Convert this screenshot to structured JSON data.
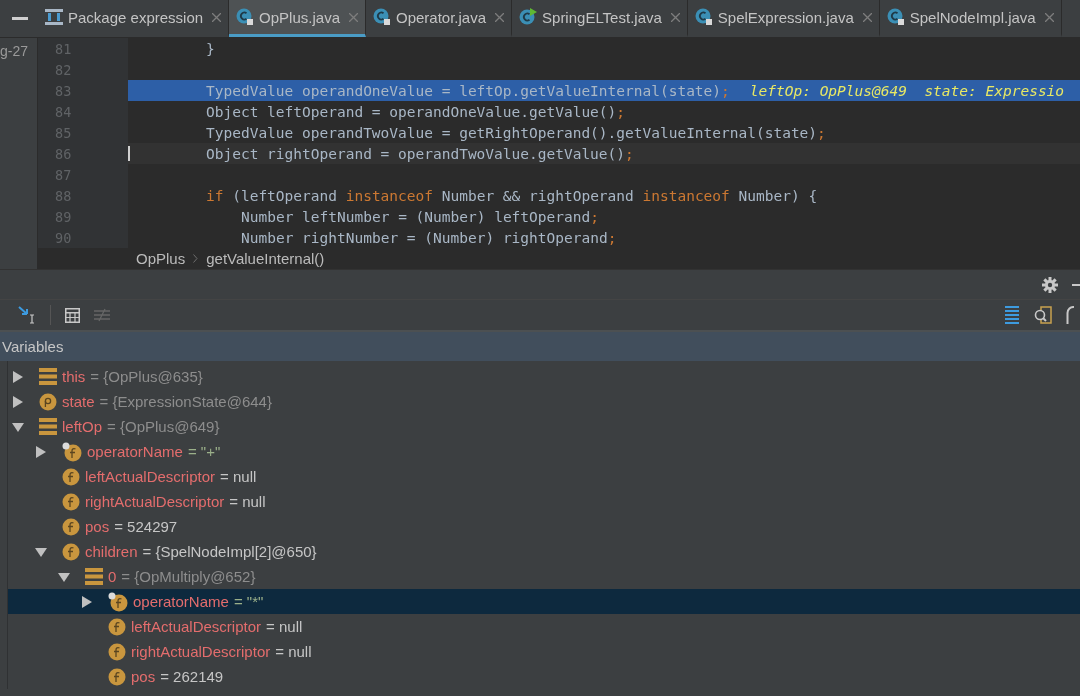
{
  "tabs": [
    {
      "label": "Package expression",
      "kind": "structure",
      "selected": false
    },
    {
      "label": "OpPlus.java",
      "kind": "class",
      "selected": true
    },
    {
      "label": "Operator.java",
      "kind": "class",
      "selected": false
    },
    {
      "label": "SpringELTest.java",
      "kind": "test",
      "selected": false
    },
    {
      "label": "SpelExpression.java",
      "kind": "class",
      "selected": false
    },
    {
      "label": "SpelNodeImpl.java",
      "kind": "class",
      "selected": false
    }
  ],
  "side_label": "g-27",
  "code": {
    "lines": [
      {
        "number": "81",
        "kind": "normal",
        "nested": false,
        "tokens": [
          {
            "kind": "plain",
            "text": "}"
          }
        ]
      },
      {
        "number": "82",
        "kind": "normal"
      },
      {
        "number": "83",
        "kind": "execution",
        "nested": false,
        "tokens": [
          {
            "kind": "plain",
            "text": "TypedValue operandOneValue = leftOp.getValueInternal(state)"
          },
          {
            "kind": "punct",
            "text": ";"
          },
          {
            "kind": "hint",
            "text": "leftOp: OpPlus@649  state: Expressio"
          }
        ]
      },
      {
        "number": "84",
        "kind": "normal",
        "nested": false,
        "tokens": [
          {
            "kind": "plain",
            "text": "Object leftOperand = operandOneValue.getValue()"
          },
          {
            "kind": "punct",
            "text": ";"
          }
        ]
      },
      {
        "number": "85",
        "kind": "normal",
        "nested": false,
        "tokens": [
          {
            "kind": "plain",
            "text": "TypedValue operandTwoValue = getRightOperand().getValueInternal(state)"
          },
          {
            "kind": "punct",
            "text": ";"
          }
        ]
      },
      {
        "number": "86",
        "kind": "caret",
        "nested": false,
        "tokens": [
          {
            "kind": "plain",
            "text": "Object rightOperand = operandTwoValue.getValue()"
          },
          {
            "kind": "punct",
            "text": ";"
          }
        ]
      },
      {
        "number": "87",
        "kind": "normal"
      },
      {
        "number": "88",
        "kind": "normal",
        "nested": false,
        "tokens": [
          {
            "kind": "keyword",
            "text": "if"
          },
          {
            "kind": "plain",
            "text": " (leftOperand "
          },
          {
            "kind": "keyword",
            "text": "instanceof"
          },
          {
            "kind": "plain",
            "text": " Number && rightOperand "
          },
          {
            "kind": "keyword",
            "text": "instanceof"
          },
          {
            "kind": "plain",
            "text": " Number) {"
          }
        ]
      },
      {
        "number": "89",
        "kind": "normal",
        "nested": true,
        "tokens": [
          {
            "kind": "plain",
            "text": "Number leftNumber = (Number) leftOperand"
          },
          {
            "kind": "punct",
            "text": ";"
          }
        ]
      },
      {
        "number": "90",
        "kind": "normal",
        "nested": true,
        "tokens": [
          {
            "kind": "plain",
            "text": "Number rightNumber = (Number) rightOperand"
          },
          {
            "kind": "punct",
            "text": ";"
          }
        ]
      }
    ]
  },
  "breadcrumb": [
    "OpPlus",
    "getValueInternal()"
  ],
  "variables": {
    "title": "Variables",
    "items": [
      {
        "name": "this",
        "value": "= {OpPlus@635}",
        "kind": "object",
        "has_children": true,
        "expanded": false,
        "selected": false
      },
      {
        "name": "state",
        "value": "= {ExpressionState@644}",
        "kind": "param",
        "has_children": true,
        "expanded": false,
        "selected": false
      },
      {
        "name": "leftOp",
        "value": "= {OpPlus@649}",
        "kind": "object",
        "has_children": true,
        "expanded": true,
        "selected": false,
        "children": [
          {
            "name": "operatorName",
            "value": "= \"+\"",
            "kind": "field_marked",
            "has_children": true,
            "expanded": false,
            "selected": false
          },
          {
            "name": "leftActualDescriptor",
            "value": "= null",
            "kind": "field",
            "has_children": false,
            "expanded": false,
            "selected": false
          },
          {
            "name": "rightActualDescriptor",
            "value": "= null",
            "kind": "field",
            "has_children": false,
            "expanded": false,
            "selected": false
          },
          {
            "name": "pos",
            "value": "= 524297",
            "kind": "field",
            "has_children": false,
            "expanded": false,
            "selected": false
          },
          {
            "name": "children",
            "value": "= {SpelNodeImpl[2]@650}",
            "kind": "field",
            "has_children": true,
            "expanded": true,
            "selected": false,
            "children": [
              {
                "name": "0",
                "value": "= {OpMultiply@652}",
                "kind": "object",
                "has_children": true,
                "expanded": true,
                "selected": false,
                "children": [
                  {
                    "name": "operatorName",
                    "value": "= \"*\"",
                    "kind": "field_marked",
                    "has_children": true,
                    "expanded": false,
                    "selected": true
                  },
                  {
                    "name": "leftActualDescriptor",
                    "value": "= null",
                    "kind": "field",
                    "has_children": false,
                    "expanded": false,
                    "selected": false
                  },
                  {
                    "name": "rightActualDescriptor",
                    "value": "= null",
                    "kind": "field",
                    "has_children": false,
                    "expanded": false,
                    "selected": false
                  },
                  {
                    "name": "pos",
                    "value": "= 262149",
                    "kind": "field",
                    "has_children": false,
                    "expanded": false,
                    "selected": false
                  }
                ]
              }
            ]
          }
        ]
      }
    ]
  }
}
